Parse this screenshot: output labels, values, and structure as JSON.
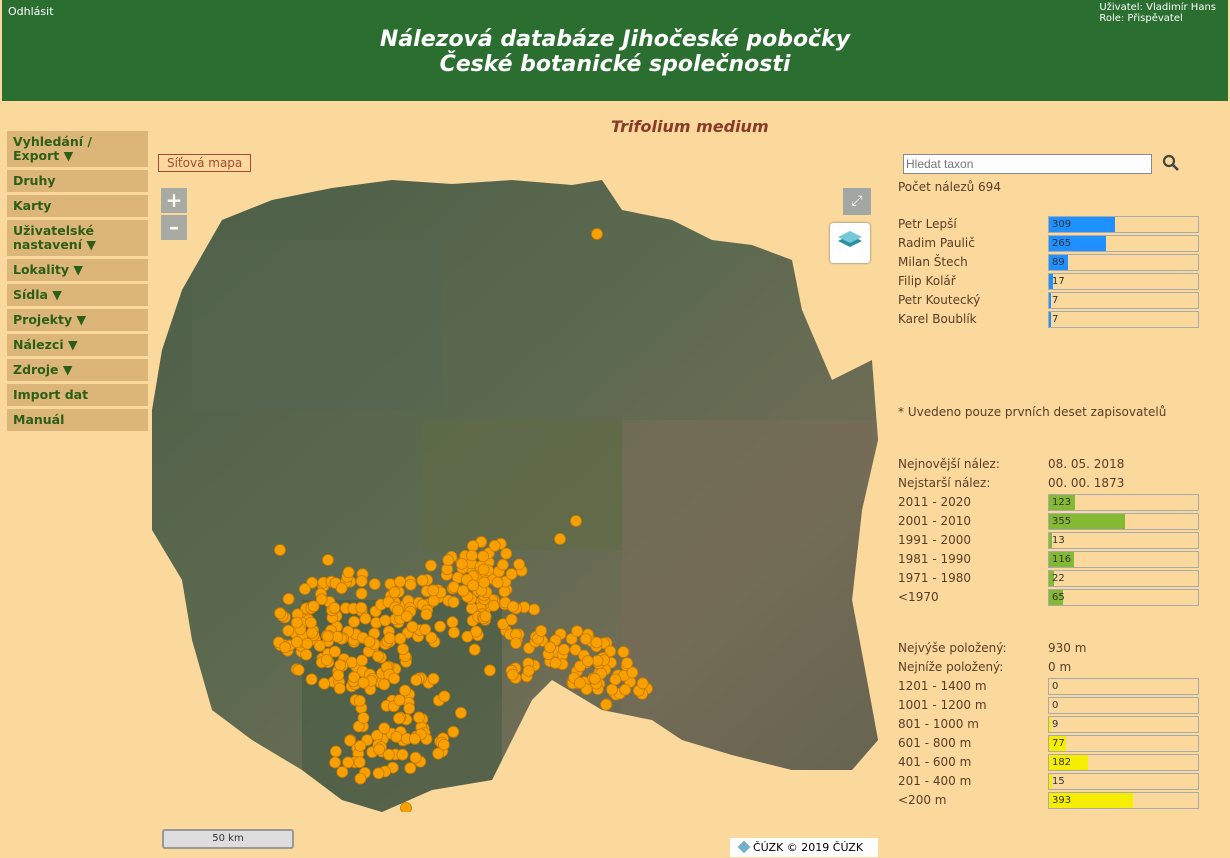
{
  "header": {
    "logout": "Odhlásit",
    "user": "Uživatel: Vladimír Hans",
    "role": "Role: Přispěvatel",
    "title_line1": "Nálezová databáze Jihočeské pobočky",
    "title_line2": "České botanické společnosti"
  },
  "sidebar": {
    "items": [
      {
        "label": "Vyhledání / Export ▼"
      },
      {
        "label": "Druhy"
      },
      {
        "label": "Karty"
      },
      {
        "label": "Uživatelské nastavení ▼"
      },
      {
        "label": "Lokality ▼"
      },
      {
        "label": "Sídla ▼"
      },
      {
        "label": "Projekty ▼"
      },
      {
        "label": "Nálezci ▼"
      },
      {
        "label": "Zdroje ▼"
      },
      {
        "label": "Import dat"
      },
      {
        "label": "Manuál"
      }
    ]
  },
  "taxon": "Trifolium medium",
  "map": {
    "grid_button": "Síťová mapa",
    "zoom_in": "+",
    "zoom_out": "–",
    "scale": "50 km",
    "copyright": "ČÚZK © 2019 ČÚZK",
    "marker_color": "#f7a000"
  },
  "search": {
    "placeholder": "Hledat taxon"
  },
  "stats": {
    "count": "Počet nálezů 694",
    "observers": [
      {
        "name": "Petr Lepší",
        "value": 309
      },
      {
        "name": "Radim Paulič",
        "value": 265
      },
      {
        "name": "Milan Štech",
        "value": 89
      },
      {
        "name": "Filip Kolář",
        "value": 17
      },
      {
        "name": "Petr Koutecký",
        "value": 7
      },
      {
        "name": "Karel Boublík",
        "value": 7
      }
    ],
    "observers_color": "#1e90ff",
    "note": "* Uvedeno pouze prvních deset zapisovatelů",
    "newest_label": "Nejnovější nález:",
    "newest_value": "08. 05. 2018",
    "oldest_label": "Nejstarší nález:",
    "oldest_value": "00. 00. 1873",
    "years": [
      {
        "label": "2011 - 2020",
        "value": 123
      },
      {
        "label": "2001 - 2010",
        "value": 355
      },
      {
        "label": "1991 - 2000",
        "value": 13
      },
      {
        "label": "1981 - 1990",
        "value": 116
      },
      {
        "label": "1971 - 1980",
        "value": 22
      },
      {
        "label": "<1970",
        "value": 65
      }
    ],
    "years_color": "#84b934",
    "highest_label": "Nejvýše položený:",
    "highest_value": "930 m",
    "lowest_label": "Nejníže položený:",
    "lowest_value": "0 m",
    "altitudes": [
      {
        "label": "1201 - 1400 m",
        "value": 0
      },
      {
        "label": "1001 - 1200 m",
        "value": 0
      },
      {
        "label": "801 - 1000 m",
        "value": 9
      },
      {
        "label": "601 - 800 m",
        "value": 77
      },
      {
        "label": "401 - 600 m",
        "value": 182
      },
      {
        "label": "201 - 400 m",
        "value": 15
      },
      {
        "label": "<200 m",
        "value": 393
      }
    ],
    "altitudes_color": "#f5ee00"
  }
}
